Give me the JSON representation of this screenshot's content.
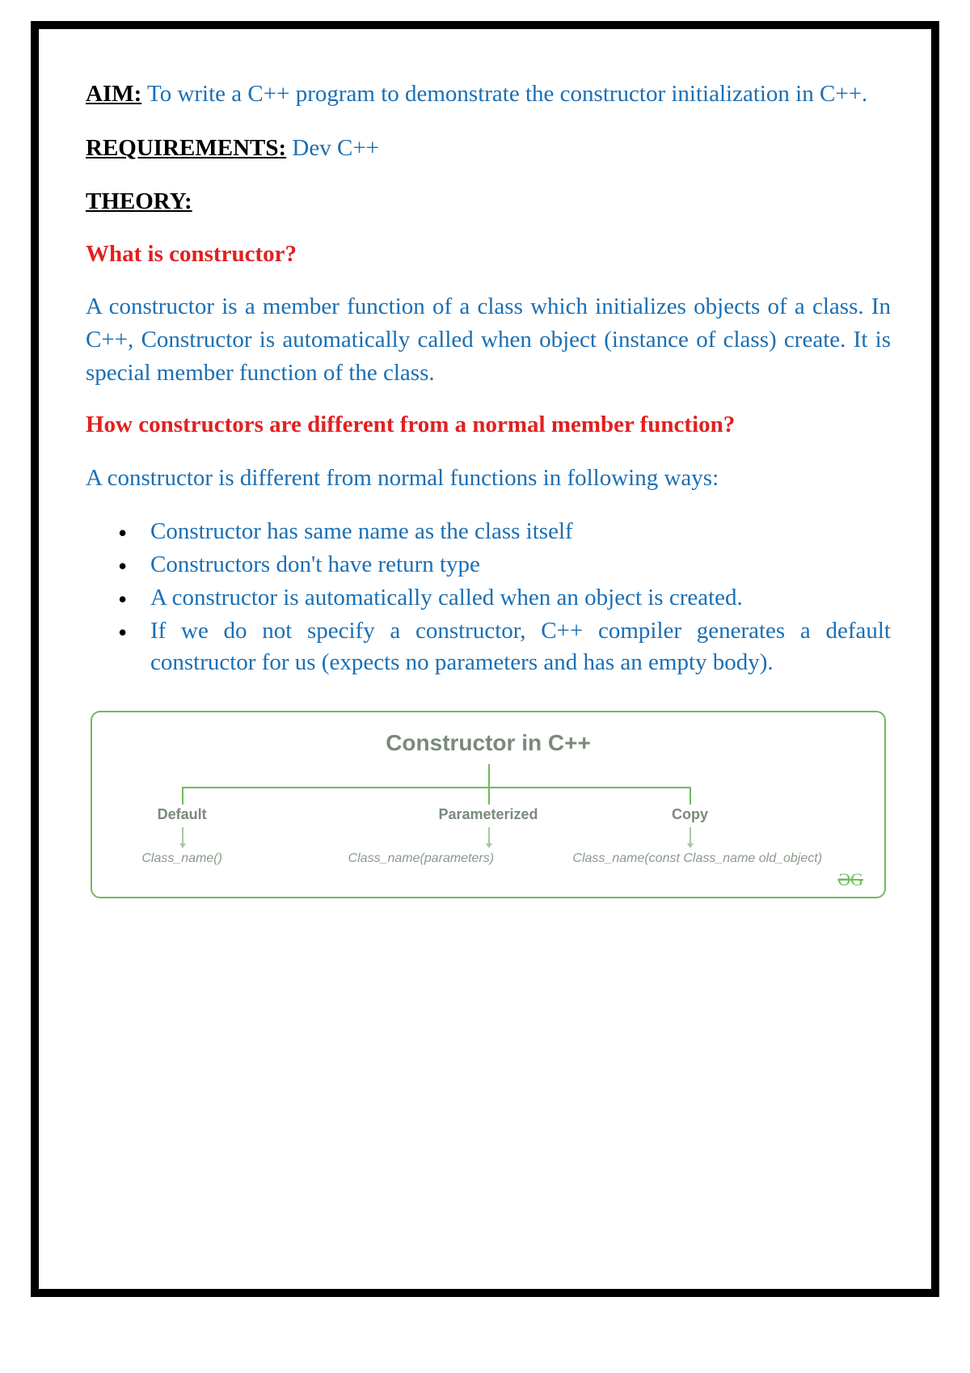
{
  "headings": {
    "aim": "AIM:",
    "requirements": "REQUIREMENTS:",
    "theory": "THEORY:"
  },
  "aim_text": " To write a C++ program to demonstrate the constructor initialization in C++.",
  "requirements_text": " Dev C++",
  "q1": "What is constructor?",
  "a1": "A constructor is a member function of a class which initializes objects of a class. In C++, Constructor is automatically called when object (instance of class) create. It is special member function of the class.",
  "q2": "How constructors are different from a normal member function?",
  "a2_intro": "A constructor is different from normal functions in following ways:",
  "bullets": [
    " Constructor has same name as the class itself",
    " Constructors don't have return type",
    " A constructor is automatically called when an object is created.",
    " If we do not specify a constructor, C++ compiler generates a default constructor for us (expects no parameters and has an empty body)."
  ],
  "diagram": {
    "title": "Constructor in C++",
    "types": [
      "Default",
      "Parameterized",
      "Copy"
    ],
    "signatures": [
      "Class_name()",
      "Class_name(parameters)",
      "Class_name(const Class_name old_object)"
    ],
    "watermark": "ƏG"
  }
}
